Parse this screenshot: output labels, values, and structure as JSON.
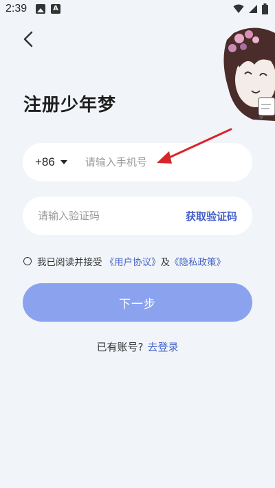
{
  "status_bar": {
    "time": "2:39",
    "left_icons": [
      "photo-icon",
      "a-icon"
    ],
    "right_icons": [
      "wifi-icon",
      "signal-icon",
      "battery-icon"
    ]
  },
  "header": {
    "back_icon": "chevron-left-icon"
  },
  "title": "注册少年梦",
  "phone": {
    "country_code": "+86",
    "placeholder": "请输入手机号",
    "value": ""
  },
  "code": {
    "placeholder": "请输入验证码",
    "value": "",
    "get_code_label": "获取验证码"
  },
  "agreement": {
    "prefix": "我已阅读并接受",
    "user_agreement": "《用户协议》",
    "and": "及",
    "privacy_policy": "《隐私政策》",
    "checked": false
  },
  "next_button": "下一步",
  "login": {
    "prompt": "已有账号?",
    "link": "去登录"
  },
  "colors": {
    "background": "#f1f5f9",
    "accent": "#4561c9",
    "button": "#8ba3ef",
    "arrow": "#d7262b"
  }
}
